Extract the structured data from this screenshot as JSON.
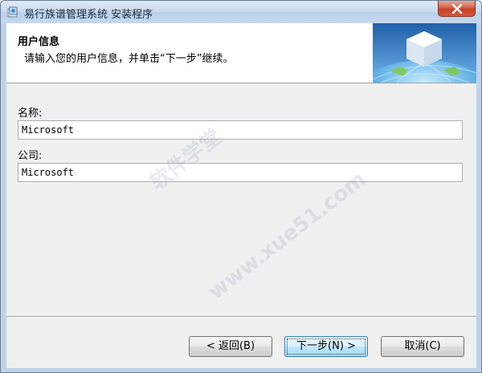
{
  "window": {
    "title": "易行族谱管理系统 安装程序"
  },
  "header": {
    "title": "用户信息",
    "subtitle": "请输入您的用户信息，并单击“下一步”继续。"
  },
  "form": {
    "name_label": "名称:",
    "name_value": "Microsoft",
    "company_label": "公司:",
    "company_value": "Microsoft"
  },
  "buttons": {
    "back": "< 返回(B)",
    "next": "下一步(N) >",
    "cancel": "取消(C)"
  },
  "icons": {
    "app": "installer-icon",
    "close": "close-icon",
    "header_graphic": "cube-globe-graphic"
  },
  "watermark": {
    "text_1": "软件学堂",
    "text_2": "www.xue51.com"
  }
}
